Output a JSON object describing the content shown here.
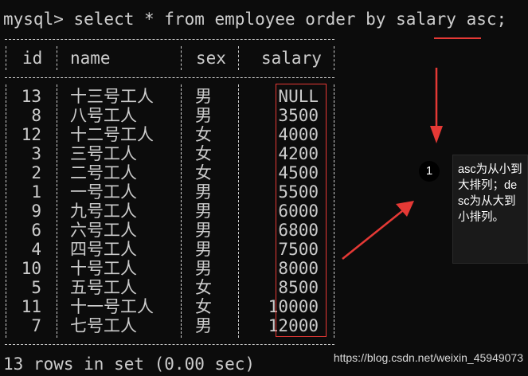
{
  "terminal": {
    "prompt": "mysql>",
    "command": " select * from employee order by salary asc;",
    "columns": [
      "id",
      "name",
      "sex",
      "salary"
    ],
    "rows": [
      {
        "id": "13",
        "name": "十三号工人",
        "sex": "男",
        "salary": "NULL"
      },
      {
        "id": "8",
        "name": "八号工人",
        "sex": "男",
        "salary": "3500"
      },
      {
        "id": "12",
        "name": "十二号工人",
        "sex": "女",
        "salary": "4000"
      },
      {
        "id": "3",
        "name": "三号工人",
        "sex": "女",
        "salary": "4200"
      },
      {
        "id": "2",
        "name": "二号工人",
        "sex": "女",
        "salary": "4500"
      },
      {
        "id": "1",
        "name": "一号工人",
        "sex": "男",
        "salary": "5500"
      },
      {
        "id": "9",
        "name": "九号工人",
        "sex": "男",
        "salary": "6000"
      },
      {
        "id": "6",
        "name": "六号工人",
        "sex": "男",
        "salary": "6800"
      },
      {
        "id": "4",
        "name": "四号工人",
        "sex": "男",
        "salary": "7500"
      },
      {
        "id": "10",
        "name": "十号工人",
        "sex": "男",
        "salary": "8000"
      },
      {
        "id": "5",
        "name": "五号工人",
        "sex": "女",
        "salary": "8500"
      },
      {
        "id": "11",
        "name": "十一号工人",
        "sex": "女",
        "salary": "10000"
      },
      {
        "id": "7",
        "name": "七号工人",
        "sex": "男",
        "salary": "12000"
      }
    ],
    "footer": "13 rows in set (0.00 sec)"
  },
  "annotation": {
    "badge": "1",
    "note": "asc为从小到大排列；desc为从大到小排列。",
    "accent_color": "#e53935"
  },
  "watermark": "https://blog.csdn.net/weixin_45949073",
  "colors": {
    "background": "#0c0c0c",
    "text": "#cccccc"
  }
}
